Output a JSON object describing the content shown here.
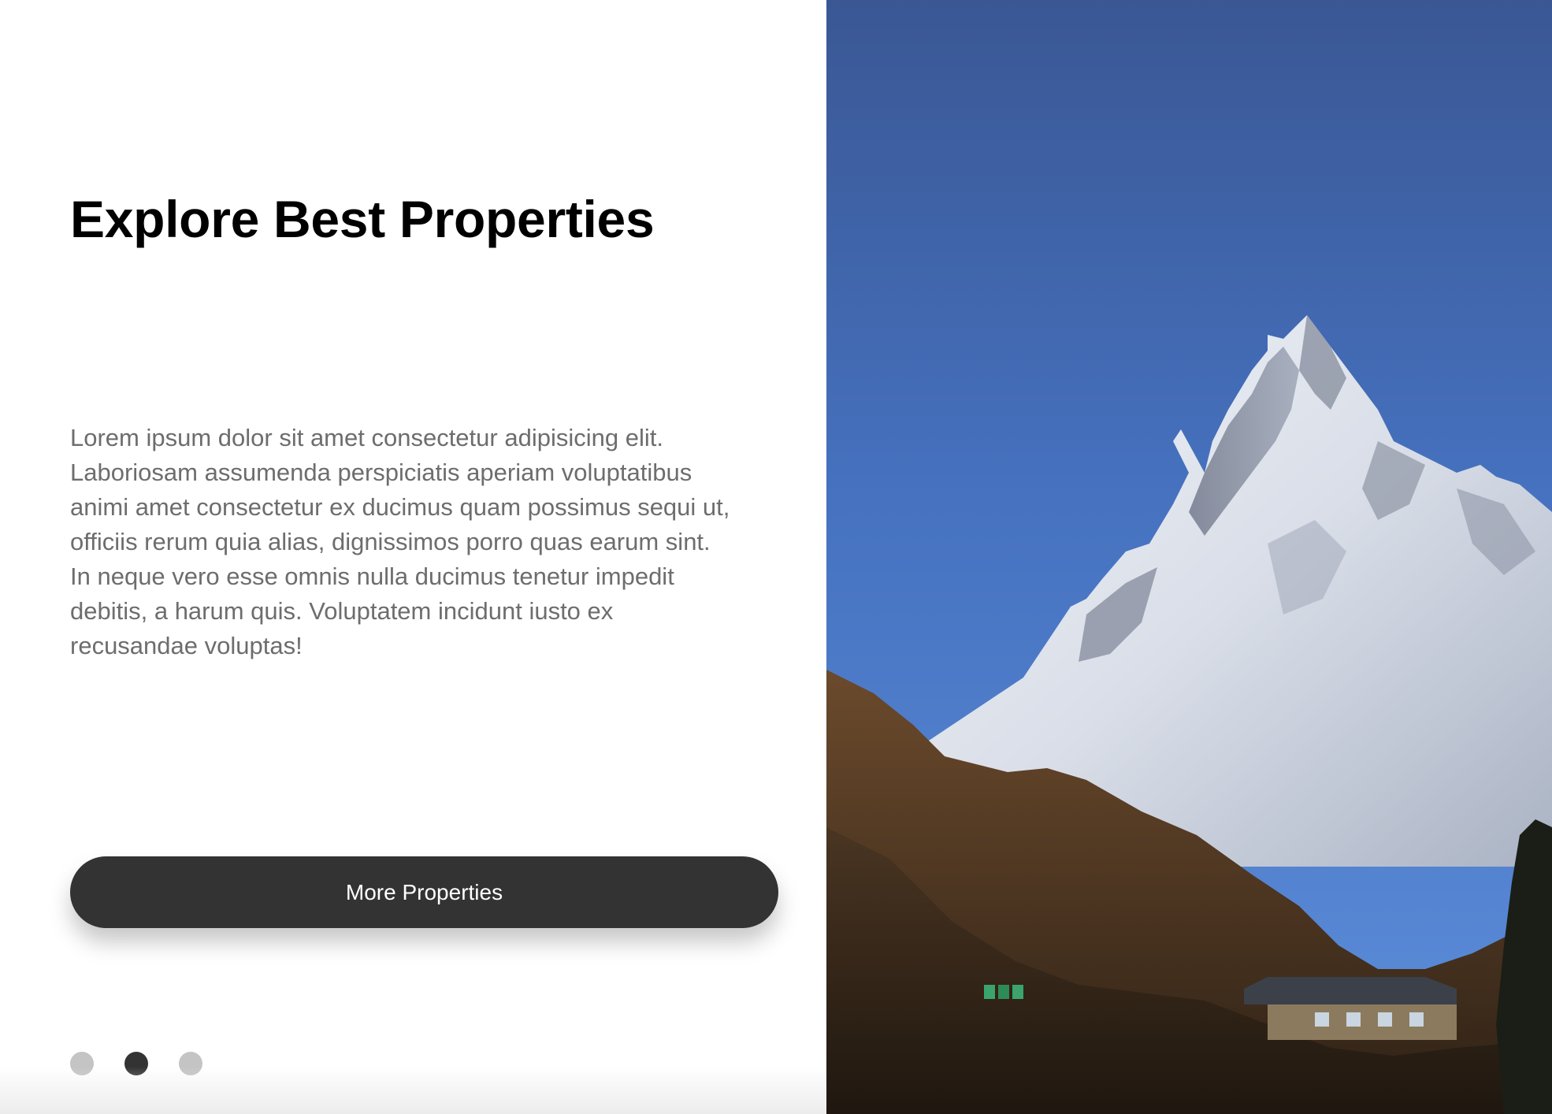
{
  "slide": {
    "title": "Explore Best Properties",
    "description": "Lorem ipsum dolor sit amet consectetur adipisicing elit. Laboriosam assumenda perspiciatis aperiam voluptatibus animi amet consectetur ex ducimus quam possimus sequi ut, officiis rerum quia alias, dignissimos porro quas earum sint. In neque vero esse omnis nulla ducimus tenetur impedit debitis, a harum quis. Voluptatem incidunt iusto ex recusandae voluptas!",
    "button_label": "More Properties"
  },
  "pagination": {
    "total": 3,
    "active_index": 2
  },
  "image": {
    "subject": "snow-capped mountain peak with hillside lodge under clear blue sky"
  },
  "colors": {
    "button_bg": "#333333",
    "dot_active": "#333333",
    "dot_inactive": "#c4c4c4",
    "body_text": "#6d6d6d",
    "sky_top": "#3a5794",
    "sky_bottom": "#5b8ad4"
  }
}
